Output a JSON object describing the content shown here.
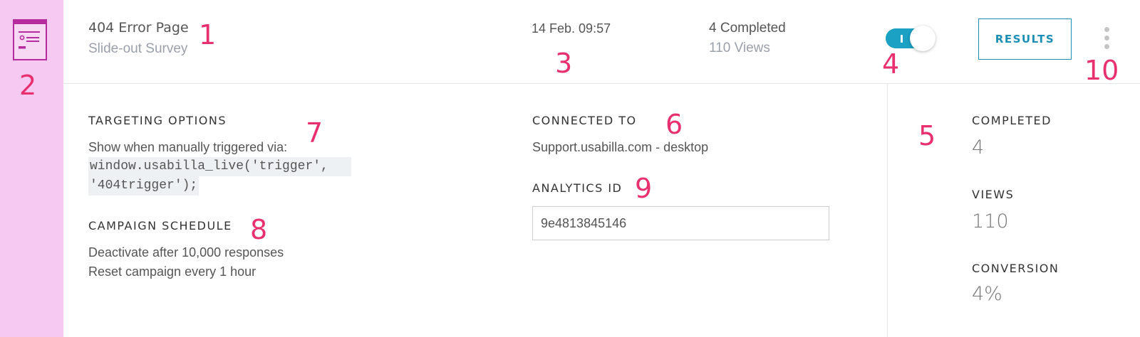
{
  "sidebar": {
    "icon": "survey-form-icon"
  },
  "header": {
    "title": "404 Error Page",
    "subtitle": "Slide-out Survey",
    "datetime": "14 Feb. 09:57",
    "completed": "4 Completed",
    "views": "110 Views",
    "toggle_on": true,
    "results_label": "RESULTS",
    "more_icon": "more-vertical-icon"
  },
  "targeting": {
    "heading": "TARGETING OPTIONS",
    "text": "Show when manually triggered via:",
    "code_line1": "window.usabilla_live('trigger',",
    "code_line2": "'404trigger');"
  },
  "schedule": {
    "heading": "CAMPAIGN SCHEDULE",
    "line1": "Deactivate after 10,000 responses",
    "line2": "Reset campaign every 1 hour"
  },
  "connected": {
    "heading": "CONNECTED TO",
    "value": "Support.usabilla.com - desktop"
  },
  "analytics": {
    "heading": "ANALYTICS ID",
    "value": "9e4813845146"
  },
  "stats": {
    "completed_label": "COMPLETED",
    "completed_value": "4",
    "views_label": "VIEWS",
    "views_value": "110",
    "conversion_label": "CONVERSION",
    "conversion_value": "4%"
  },
  "annotations": [
    "1",
    "2",
    "3",
    "4",
    "5",
    "6",
    "7",
    "8",
    "9",
    "10"
  ],
  "colors": {
    "accent": "#1a8fb5",
    "toggle": "#1aa1c4",
    "sidebar": "#f5c9f1",
    "annotation": "#e8306e",
    "icon": "#b62c9e"
  }
}
